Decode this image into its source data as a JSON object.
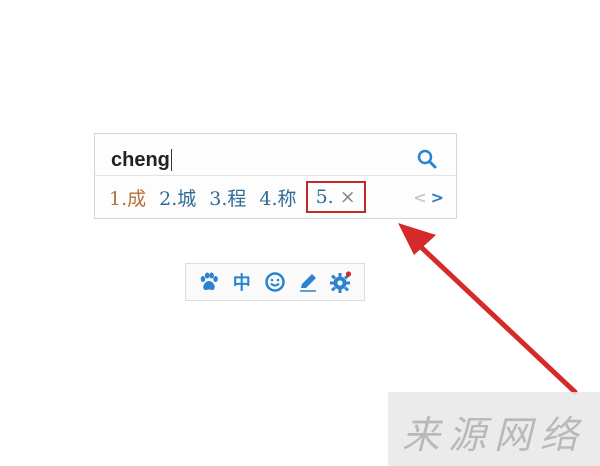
{
  "ime": {
    "input_text": "cheng",
    "candidates": [
      {
        "label": "1.成"
      },
      {
        "label": "2.城"
      },
      {
        "label": "3.程"
      },
      {
        "label": "4.称"
      }
    ],
    "highlighted": {
      "label": "5.",
      "close_glyph": "×"
    },
    "pager": {
      "prev": "<",
      "next": ">"
    }
  },
  "toolbar": {
    "buttons": [
      {
        "icon": "paw-icon"
      },
      {
        "label": "中"
      },
      {
        "icon": "smiley-icon"
      },
      {
        "icon": "pen-icon"
      },
      {
        "icon": "gear-icon"
      }
    ]
  },
  "watermark": {
    "text": "来源网络"
  },
  "colors": {
    "accent": "#2b83d0",
    "highlight_border": "#c22a2a",
    "arrow": "#d42a2a",
    "first_candidate": "#b8703d",
    "candidate": "#2f6d96"
  }
}
